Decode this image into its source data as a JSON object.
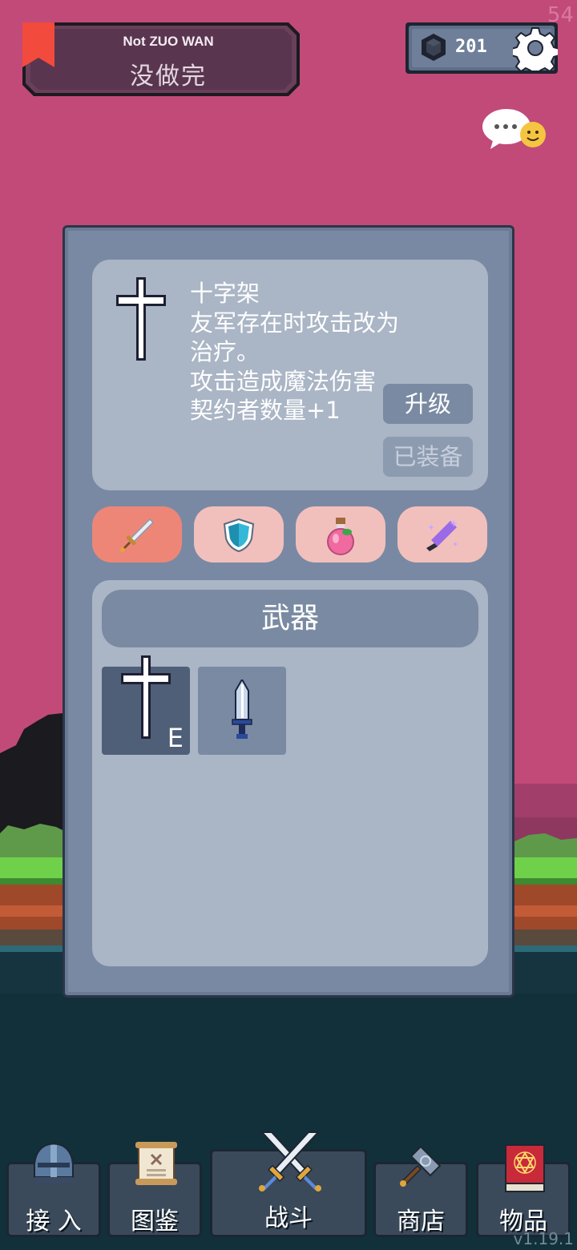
{
  "hud": {
    "fps": "54",
    "version": "v1.19.1",
    "save_title_en": "Not ZUO WAN",
    "save_title_cn": "没做完",
    "currency_value": "201"
  },
  "item_detail": {
    "name": "十字架",
    "description_lines": [
      "友军存在时攻击改为",
      "治疗。",
      "攻击造成魔法伤害",
      "契约者数量+1"
    ],
    "upgrade_label": "升级",
    "equipped_label": "已装备"
  },
  "category_tabs": [
    {
      "icon": "sword-icon",
      "active": true
    },
    {
      "icon": "shield-icon",
      "active": false
    },
    {
      "icon": "potion-icon",
      "active": false
    },
    {
      "icon": "magic-wand-icon",
      "active": false
    }
  ],
  "inventory": {
    "header": "武器",
    "slots": [
      {
        "icon": "cross-icon",
        "badge": "E",
        "selected": true
      },
      {
        "icon": "dagger-icon",
        "badge": "",
        "selected": false
      }
    ]
  },
  "nav": {
    "items": [
      {
        "label": "接 入",
        "icon": "helmet-icon"
      },
      {
        "label": "图鉴",
        "icon": "scroll-icon"
      },
      {
        "label": "战斗",
        "icon": "crossed-swords-icon"
      },
      {
        "label": "商店",
        "icon": "hammer-icon"
      },
      {
        "label": "物品",
        "icon": "spellbook-icon"
      }
    ]
  },
  "colors": {
    "sky": "#c24a78",
    "panel": "#7989a3",
    "card": "#aab5c5",
    "button": "#7a8aa2",
    "tab_active": "#ee8678",
    "tab_inactive": "#f2c0bc",
    "bookmark": "#f24a3c"
  }
}
